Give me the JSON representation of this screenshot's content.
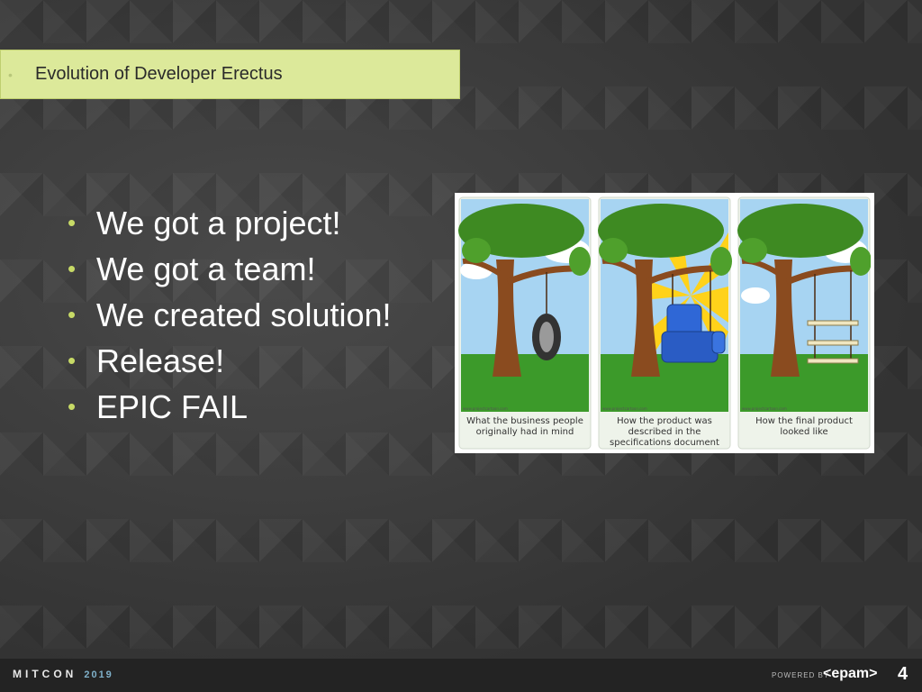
{
  "title_bar": {
    "text": "Evolution of Developer Erectus"
  },
  "bullets": [
    "We got a project!",
    "We got a team!",
    "We created solution!",
    "Release!",
    "EPIC FAIL"
  ],
  "cartoon": {
    "panels": [
      {
        "watermark": "www.projectcartoon.com",
        "caption": [
          "What the business people",
          "originally had in mind"
        ]
      },
      {
        "watermark": "www.projectcartoon.com",
        "caption": [
          "How the product was",
          "described in the",
          "specifications document"
        ]
      },
      {
        "watermark": "www.projectcartoon.com",
        "caption": [
          "How the final product",
          "looked like"
        ]
      }
    ]
  },
  "footer": {
    "logo": "MITCON",
    "year": "2019",
    "powered_by": "POWERED BY",
    "brand": "<epam>",
    "page_number": "4"
  },
  "colors": {
    "title_bar_bg": "#dce99a",
    "bullet_accent": "#c7da66",
    "sky": "#a7d4f2",
    "grass": "#3c9a2a",
    "footer_bg": "#232323"
  }
}
